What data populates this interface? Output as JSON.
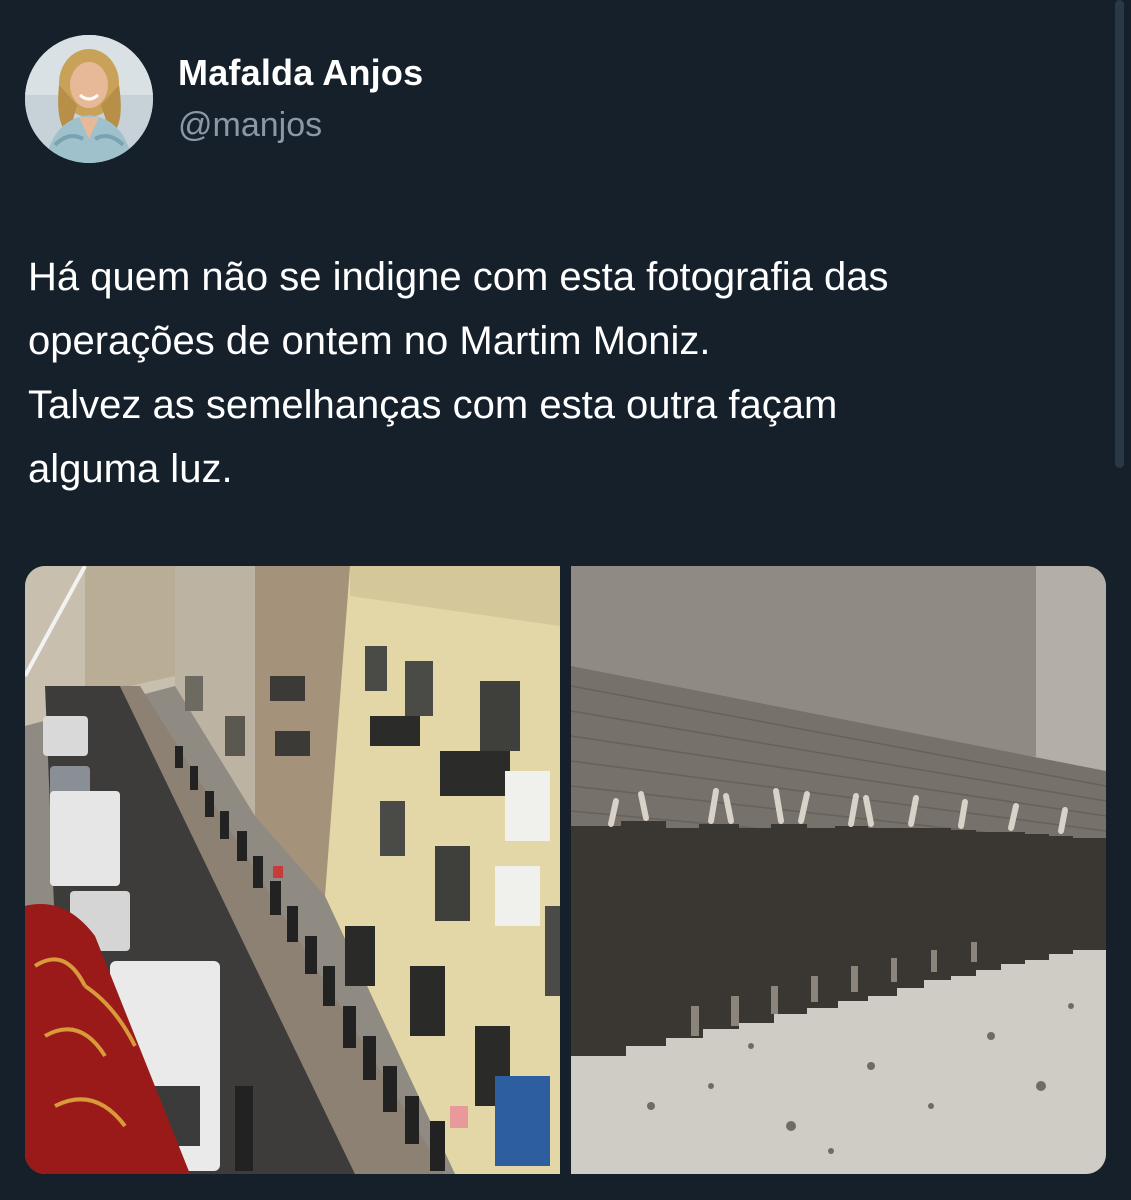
{
  "author": {
    "name": "Mafalda Anjos",
    "handle": "@manjos"
  },
  "tweet": {
    "lines": [
      "Há quem não se indigne com esta fotografia das",
      "operações de ontem no Martim Moniz.",
      "Talvez as semelhanças com esta outra façam",
      "alguma luz."
    ]
  },
  "media": [
    {
      "name": "street-photo"
    },
    {
      "name": "historical-wall-photo"
    }
  ],
  "colors": {
    "background": "#15202b",
    "text": "#ffffff",
    "secondary_text": "#8b98a5"
  }
}
